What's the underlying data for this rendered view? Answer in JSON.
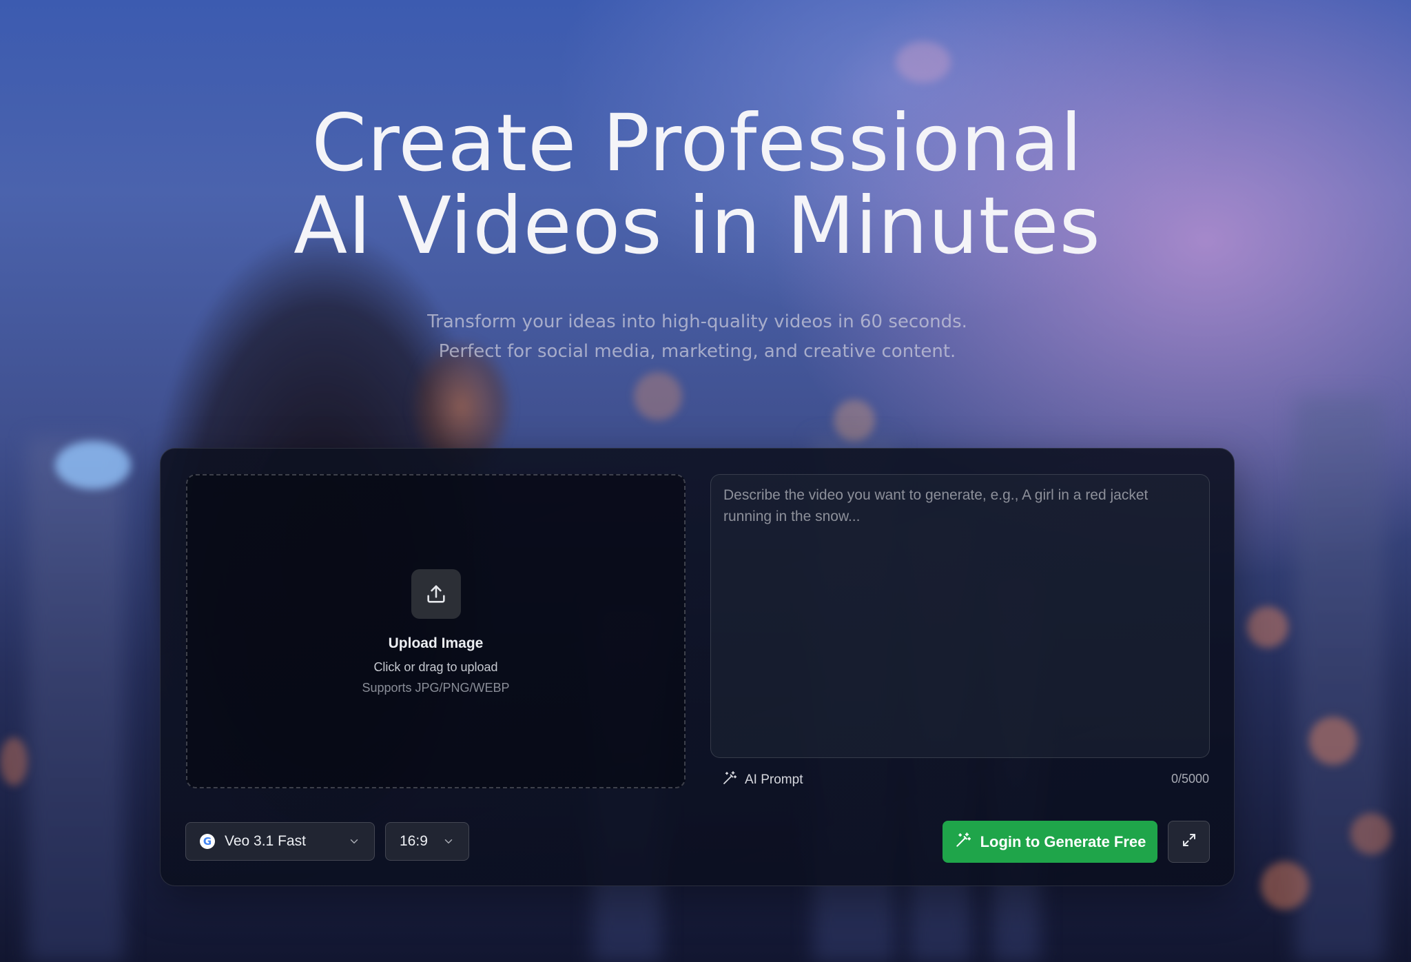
{
  "hero": {
    "title_line1": "Create Professional",
    "title_line2": "AI Videos in Minutes",
    "subtitle_line1": "Transform your ideas into high-quality videos in 60 seconds.",
    "subtitle_line2": "Perfect for social media, marketing, and creative content."
  },
  "upload": {
    "icon": "upload-icon",
    "title": "Upload Image",
    "hint": "Click or drag to upload",
    "formats": "Supports JPG/PNG/WEBP"
  },
  "prompt": {
    "value": "",
    "placeholder": "Describe the video you want to generate, e.g., A girl in a red jacket running in the snow...",
    "ai_prompt_label": "AI Prompt",
    "ai_prompt_icon": "magic-wand-icon",
    "counter": "0/5000"
  },
  "controls": {
    "model_icon": "google-logo-icon",
    "model_value": "Veo 3.1 Fast",
    "ratio_value": "16:9",
    "generate_label": "Login to Generate Free",
    "generate_icon": "magic-wand-icon",
    "expand_icon": "expand-icon"
  },
  "colors": {
    "accent_green": "#1fa54a",
    "panel_bg": "#0e1222"
  }
}
